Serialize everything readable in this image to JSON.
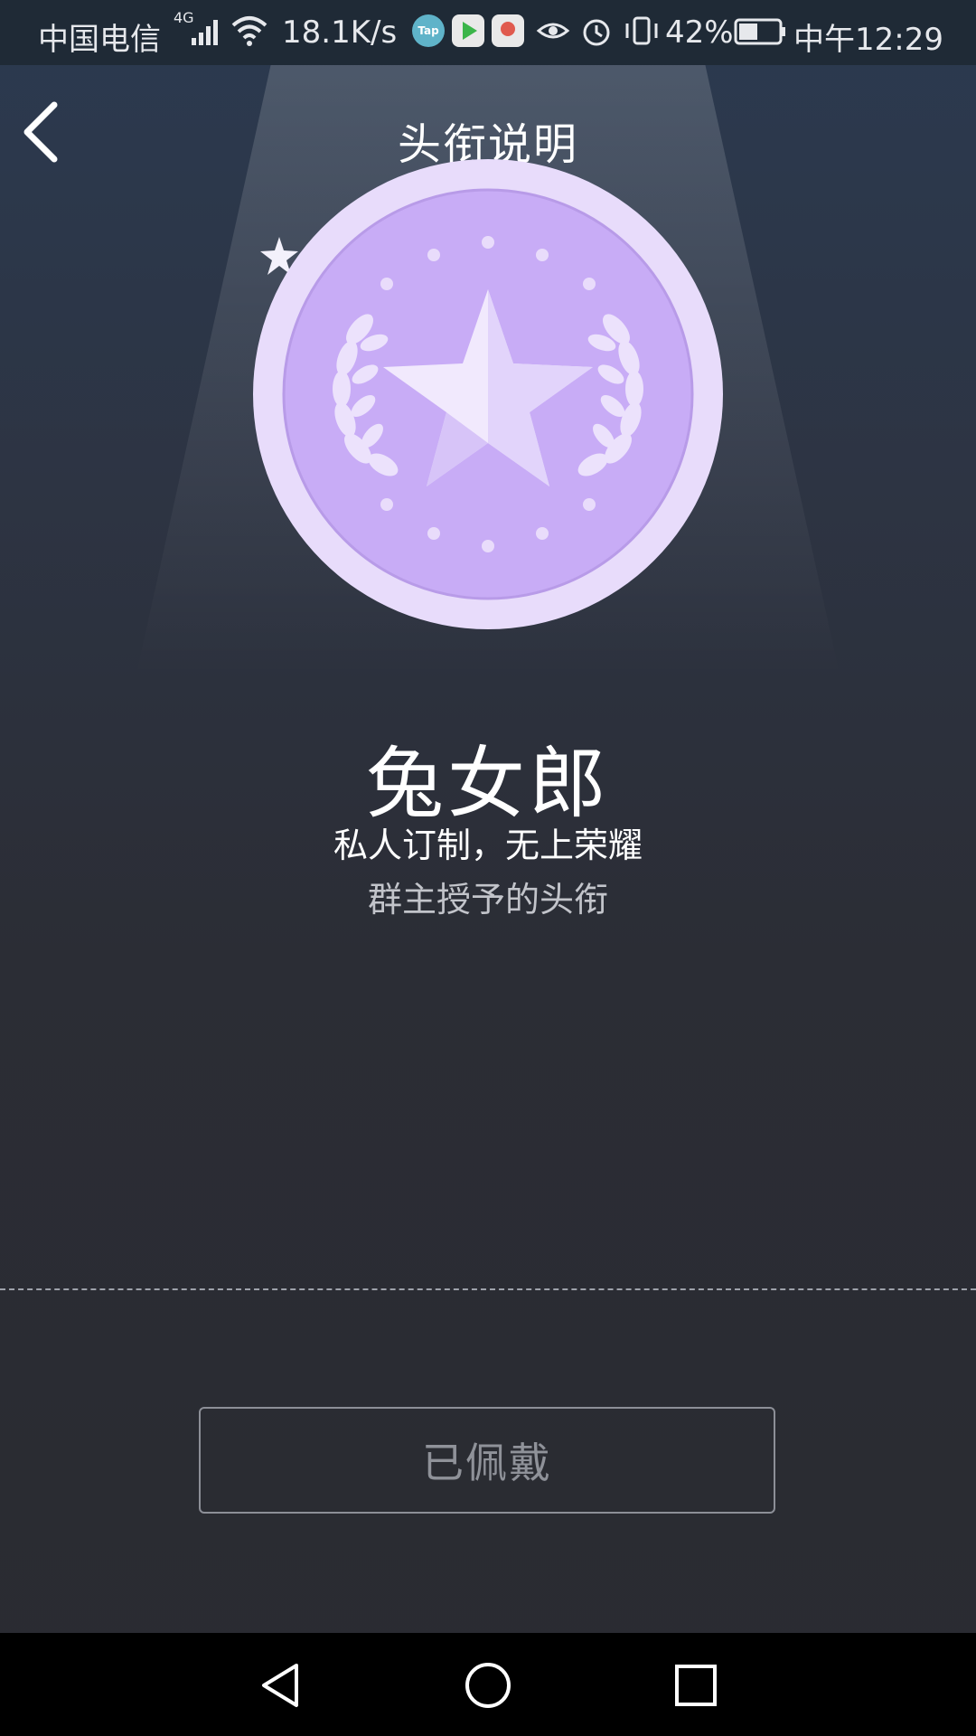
{
  "status_bar": {
    "carrier": "中国电信",
    "network": "4G",
    "speed": "18.1K/s",
    "app_icons": [
      "taptap-icon",
      "video-app-icon",
      "map-app-icon"
    ],
    "battery_percent": "42%",
    "time": "中午12:29"
  },
  "header": {
    "title": "头衔说明",
    "back_icon": "chevron-left-icon"
  },
  "medal": {
    "icon": "star-medal-icon",
    "color": "#c8acf6"
  },
  "badge": {
    "name": "兔女郎",
    "subtitle": "私人订制，无上荣耀",
    "description": "群主授予的头衔"
  },
  "action": {
    "button_label": "已佩戴"
  },
  "nav_bar": {
    "icons": [
      "back-triangle-icon",
      "home-circle-icon",
      "recents-square-icon"
    ]
  }
}
